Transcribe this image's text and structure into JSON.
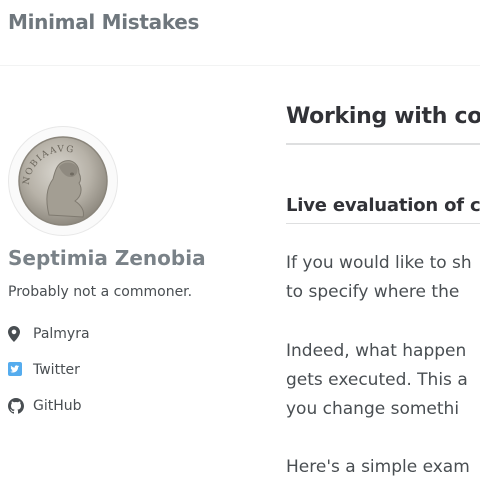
{
  "site": {
    "title": "Minimal Mistakes"
  },
  "author": {
    "name": "Septimia Zenobia",
    "bio": "Probably not a commoner.",
    "avatar_legend": "NOBIAAVG",
    "links": [
      {
        "icon": "map-marker-icon",
        "label": "Palmyra"
      },
      {
        "icon": "twitter-icon",
        "label": "Twitter"
      },
      {
        "icon": "github-icon",
        "label": "GitHub"
      }
    ]
  },
  "main": {
    "title": "Working with cod",
    "section_heading": "Live evaluation of c",
    "paragraphs": [
      [
        "If you would like to sh",
        "to specify where the"
      ],
      [
        "Indeed, what happen",
        "gets executed. This a",
        "you change somethi"
      ],
      [
        "Here's a simple exam"
      ]
    ]
  },
  "colors": {
    "site_title": "#6f777d",
    "author_name": "#7a8288",
    "heading": "#313237",
    "text": "#494e52",
    "twitter": "#55acee"
  }
}
